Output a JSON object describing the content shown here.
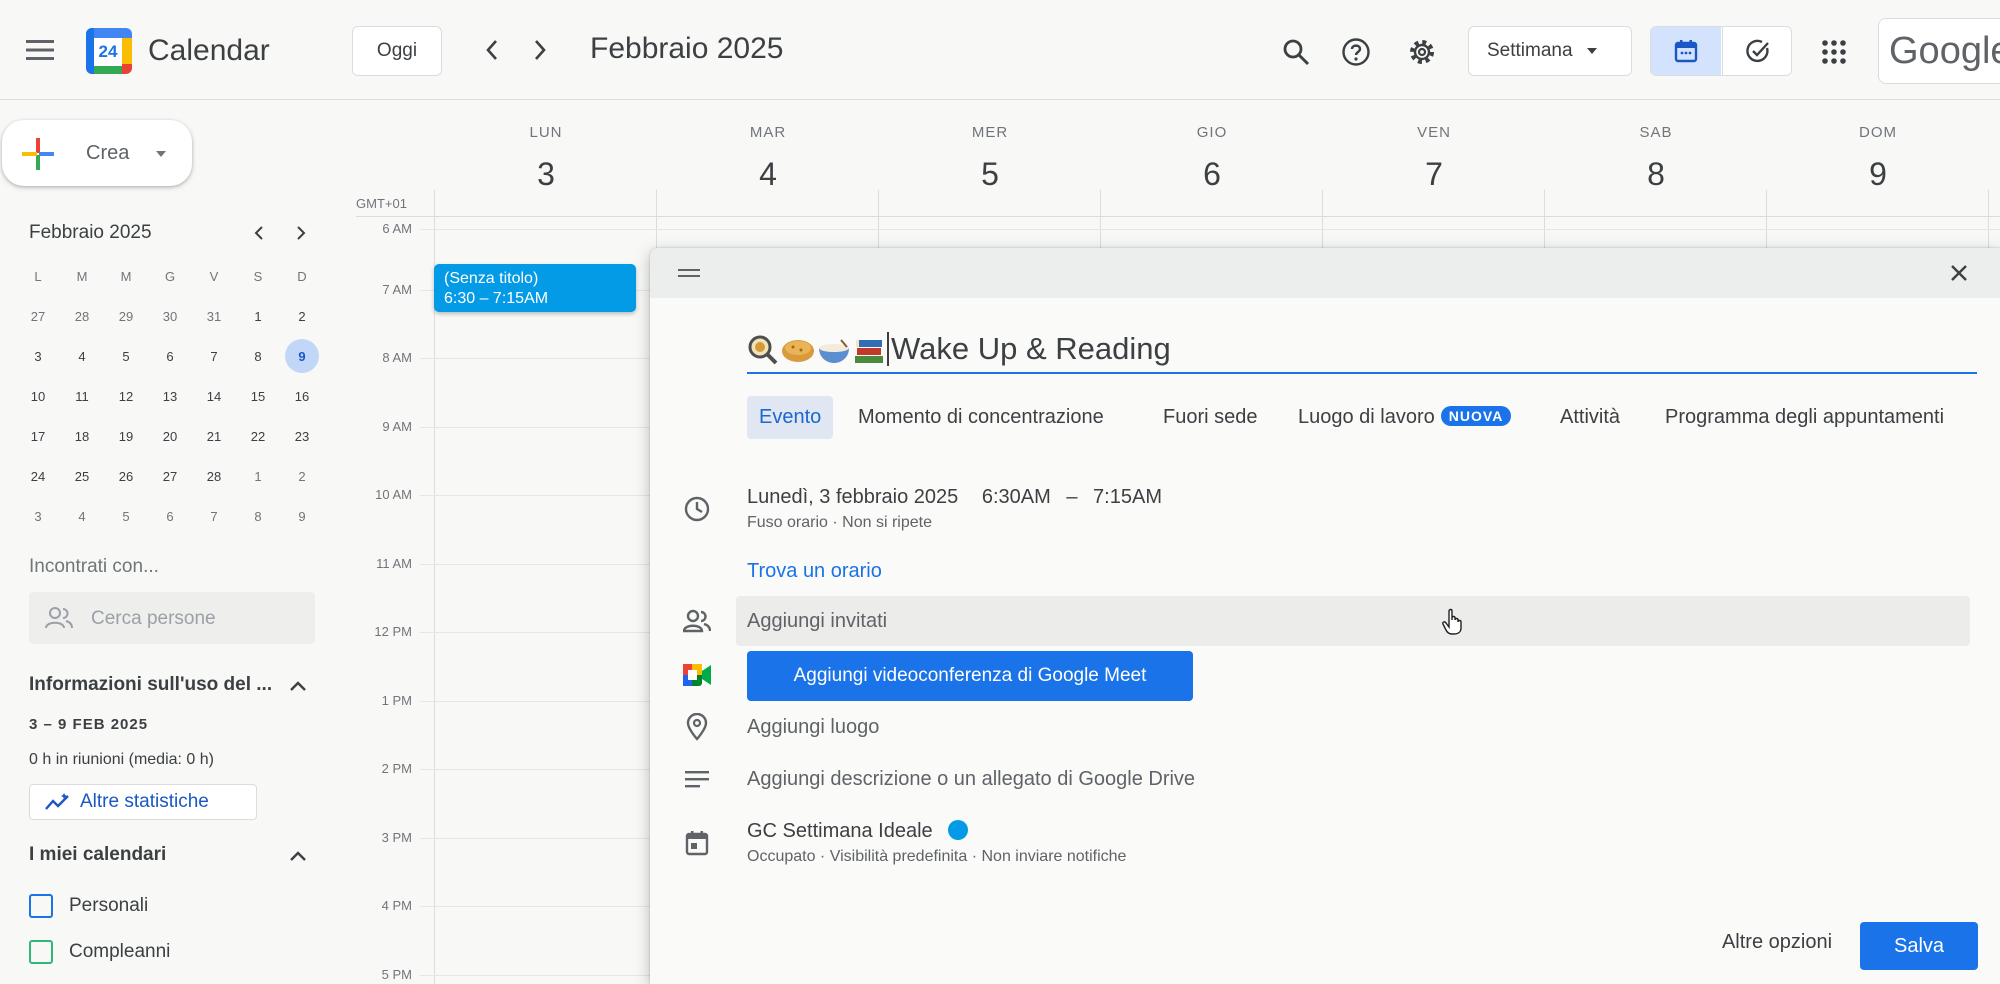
{
  "header": {
    "app_title": "Calendar",
    "logo_day": "24",
    "today_label": "Oggi",
    "month_title": "Febbraio 2025",
    "view_selector": "Settimana",
    "google_logo": "Google",
    "icons": [
      "menu-icon",
      "chevron-left-icon",
      "chevron-right-icon",
      "search-icon",
      "help-icon",
      "settings-icon",
      "calendar-view-icon",
      "tasks-view-icon",
      "apps-grid-icon"
    ]
  },
  "sidebar": {
    "create_label": "Crea",
    "mini_calendar": {
      "title": "Febbraio 2025",
      "weekdays": [
        "L",
        "M",
        "M",
        "G",
        "V",
        "S",
        "D"
      ],
      "weeks": [
        [
          "27",
          "28",
          "29",
          "30",
          "31",
          "1",
          "2"
        ],
        [
          "3",
          "4",
          "5",
          "6",
          "7",
          "8",
          "9"
        ],
        [
          "10",
          "11",
          "12",
          "13",
          "14",
          "15",
          "16"
        ],
        [
          "17",
          "18",
          "19",
          "20",
          "21",
          "22",
          "23"
        ],
        [
          "24",
          "25",
          "26",
          "27",
          "28",
          "1",
          "2"
        ],
        [
          "3",
          "4",
          "5",
          "6",
          "7",
          "8",
          "9"
        ]
      ],
      "today": "9"
    },
    "meet_with": "Incontrati con...",
    "search_people_placeholder": "Cerca persone",
    "usage_title": "Informazioni sull'uso del ...",
    "usage_range": "3 – 9 FEB 2025",
    "usage_stats": "0 h in riunioni (media: 0 h)",
    "more_stats": "Altre statistiche",
    "my_calendars_title": "I miei calendari",
    "calendars": [
      {
        "name": "Personali",
        "color": "#1a73e8"
      },
      {
        "name": "Compleanni",
        "color": "#33b679"
      }
    ]
  },
  "grid": {
    "timezone": "GMT+01",
    "days": [
      {
        "name": "LUN",
        "num": "3"
      },
      {
        "name": "MAR",
        "num": "4"
      },
      {
        "name": "MER",
        "num": "5"
      },
      {
        "name": "GIO",
        "num": "6"
      },
      {
        "name": "VEN",
        "num": "7"
      },
      {
        "name": "SAB",
        "num": "8"
      },
      {
        "name": "DOM",
        "num": "9"
      }
    ],
    "hours": [
      "6 AM",
      "7 AM",
      "8 AM",
      "9 AM",
      "10 AM",
      "11 AM",
      "12 PM",
      "1 PM",
      "2 PM",
      "3 PM",
      "4 PM",
      "5 PM"
    ],
    "event": {
      "title": "(Senza titolo)",
      "time": "6:30 – 7:15AM",
      "color": "#039be5"
    }
  },
  "dialog": {
    "title_value": "Wake Up & Reading",
    "tabs": [
      "Evento",
      "Momento di concentrazione",
      "Fuori sede",
      "Luogo di lavoro",
      "Attività",
      "Programma degli appuntamenti"
    ],
    "new_badge": "NUOVA",
    "date": "Lunedì, 3 febbraio 2025",
    "start_time": "6:30AM",
    "dash": "–",
    "end_time": "7:15AM",
    "timezone_repeat": "Fuso orario · Non si ripete",
    "find_time": "Trova un orario",
    "add_guests": "Aggiungi invitati",
    "meet_button": "Aggiungi videoconferenza di Google Meet",
    "add_location": "Aggiungi luogo",
    "add_description": "Aggiungi descrizione o un allegato di Google Drive",
    "calendar_name": "GC Settimana Ideale",
    "calendar_color": "#039be5",
    "calendar_details": "Occupato · Visibilità predefinita · Non inviare notifiche",
    "more_options": "Altre opzioni",
    "save": "Salva",
    "accent": "#1a73e8"
  }
}
